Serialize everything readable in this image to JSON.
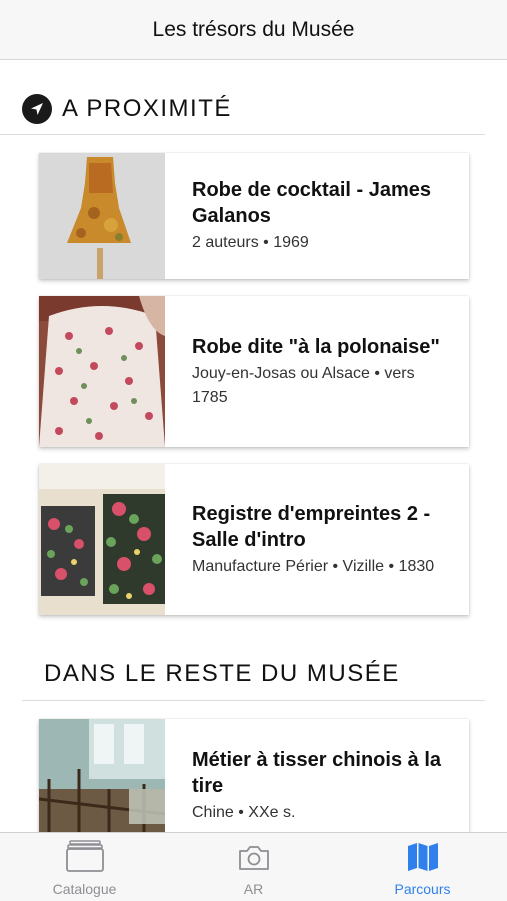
{
  "header": {
    "title": "Les trésors du Musée"
  },
  "sections": {
    "nearby": {
      "title": "A PROXIMITÉ",
      "icon": "location-arrow-icon",
      "items": [
        {
          "title": "Robe de cocktail - James Galanos",
          "meta": "2 auteurs • 1969"
        },
        {
          "title": "Robe dite \"à la polonaise\"",
          "meta": "Jouy-en-Josas ou Alsace • vers 1785"
        },
        {
          "title": "Registre d'empreintes 2 - Salle d'intro",
          "meta": "Manufacture Périer • Vizille • 1830"
        }
      ]
    },
    "rest": {
      "title": "DANS LE RESTE DU MUSÉE",
      "items": [
        {
          "title": "Métier à tisser chinois à la tire",
          "meta": "Chine • XXe s."
        }
      ]
    }
  },
  "tabbar": {
    "tabs": [
      {
        "label": "Catalogue",
        "icon": "catalogue-icon"
      },
      {
        "label": "AR",
        "icon": "camera-icon"
      },
      {
        "label": "Parcours",
        "icon": "map-icon"
      }
    ],
    "active_color": "#2f80ed",
    "inactive_color": "#8e8e93"
  }
}
